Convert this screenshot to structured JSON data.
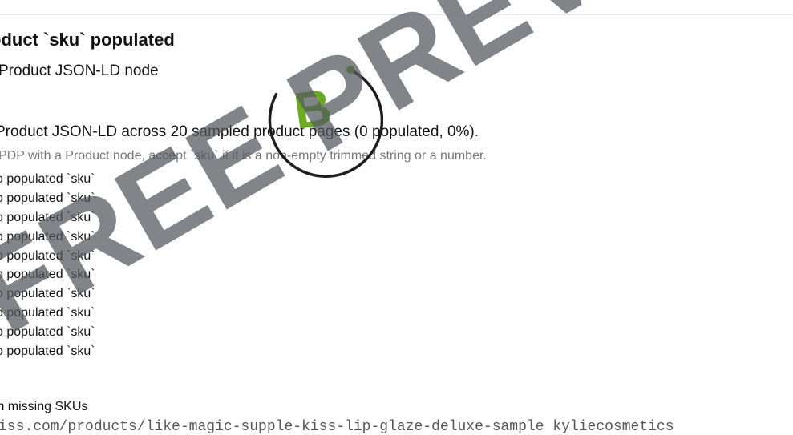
{
  "check": {
    "title": "oduct `sku` populated",
    "subtitle": "Product JSON-LD node",
    "summary": "Product JSON-LD across 20 sampled product pages (0 populated, 0%).",
    "rule": "PDP with a Product node, accept `sku` if it is a non-empty trimmed string or a number.",
    "missing_items": [
      "o populated `sku`",
      "o populated `sku`",
      "o populated `sku`",
      "o populated `sku`",
      "o populated `sku`",
      "o populated `sku`",
      "o populated `sku`",
      "o populated `sku`",
      "o populated `sku`",
      "o populated `sku`"
    ],
    "footer_heading": "th missing SKUs",
    "url_line": "iss.com/products/like-magic-supple-kiss-lip-glaze-deluxe-sample  kyliecosmetics"
  },
  "grade": {
    "letter": "B",
    "accent_color": "#6aab1f"
  },
  "watermark": {
    "text": "FREE PREVIEW"
  }
}
